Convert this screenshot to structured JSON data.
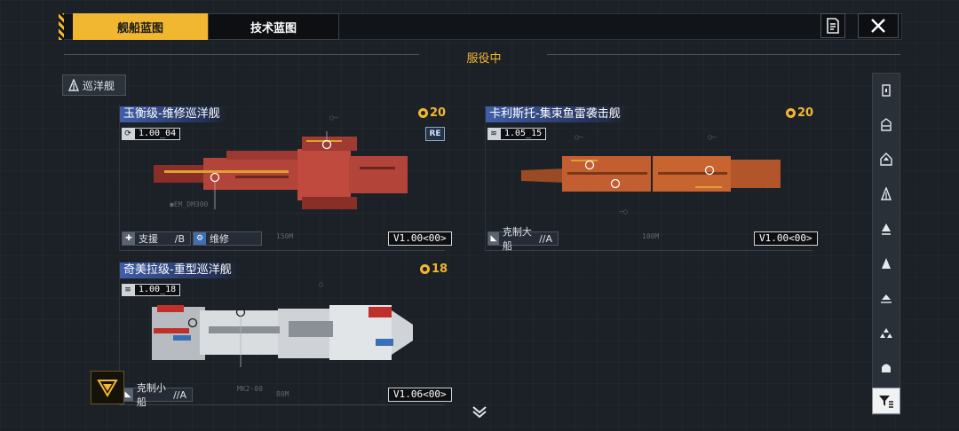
{
  "tabs": [
    {
      "label": "舰船蓝图",
      "active": true
    },
    {
      "label": "技术蓝图",
      "active": false
    }
  ],
  "section_title": "服役中",
  "class_filter": {
    "label": "巡洋舰"
  },
  "ships": [
    {
      "name": "玉衡级-维修巡洋舰",
      "version_num": "1.00",
      "version_suffix": "04",
      "cost": "20",
      "badge": "RE",
      "role1_label": "支援",
      "role1_grade": "/B",
      "role2_label": "维修",
      "version_string": "V1.00<00>",
      "colors": {
        "hull": "#b3443a",
        "hull_dark": "#6b2620",
        "accent": "#e0a030"
      }
    },
    {
      "name": "卡利斯托-集束鱼雷袭击舰",
      "version_num": "1.05",
      "version_suffix": "15",
      "cost": "20",
      "role1_label": "克制大船",
      "role1_grade": "//A",
      "version_string": "V1.00<00>",
      "colors": {
        "hull": "#c25e2f",
        "hull_dark": "#7a3818",
        "accent": "#e0a030"
      }
    },
    {
      "name": "奇美拉级-重型巡洋舰",
      "version_num": "1.00",
      "version_suffix": "18",
      "cost": "18",
      "role1_label": "克制小船",
      "role1_grade": "//A",
      "version_string": "V1.06<00>",
      "colors": {
        "hull": "#d9dde0",
        "hull_dark": "#8a9096",
        "accent": "#c0302a",
        "accent2": "#3a6fb5"
      }
    }
  ],
  "sidebar_icons": [
    "ship-class-1-icon",
    "ship-class-2-icon",
    "ship-class-3-icon",
    "ship-class-4-icon",
    "ship-class-5-icon",
    "ship-class-6-icon",
    "ship-class-7-icon",
    "ship-class-8-icon",
    "ship-class-9-icon"
  ],
  "theme": {
    "accent": "#f2b731",
    "background": "#1c2128"
  }
}
